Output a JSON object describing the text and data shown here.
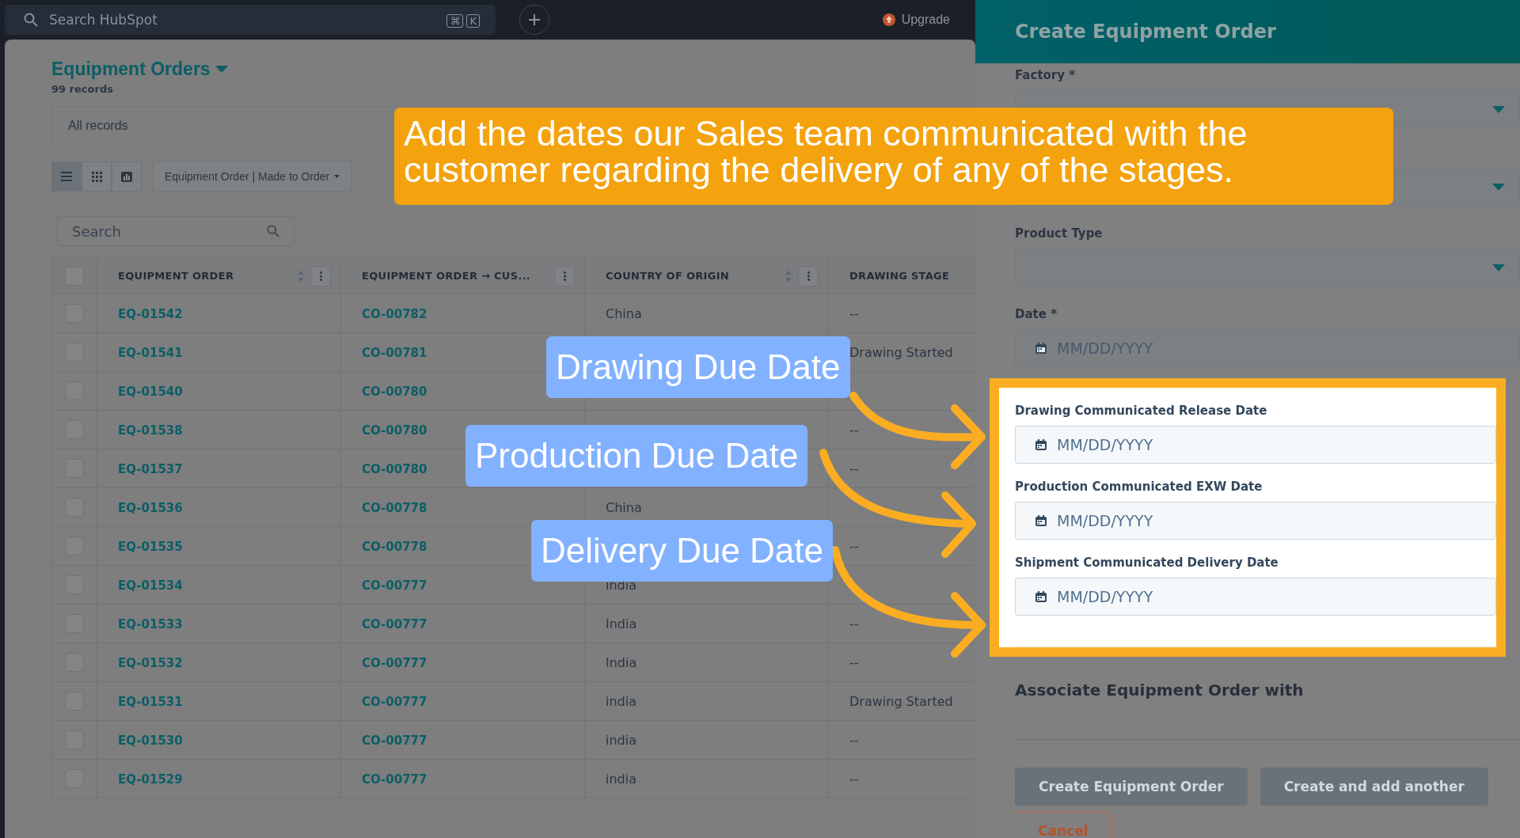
{
  "top_bar": {
    "search_placeholder": "Search HubSpot",
    "shortcut_keys": [
      "⌘",
      "K"
    ],
    "upgrade": "Upgrade"
  },
  "list": {
    "title": "Equipment Orders",
    "record_count": "99 records",
    "view_tab": "All records",
    "views": [
      {
        "kind": "list",
        "selected": true
      },
      {
        "kind": "grid",
        "selected": false
      },
      {
        "kind": "chart",
        "selected": false
      }
    ],
    "filter": "Equipment Order | Made to Order",
    "search_placeholder": "Search",
    "table": {
      "columns": [
        {
          "label": "EQUIPMENT ORDER",
          "sortable": true,
          "menu": true
        },
        {
          "label": "EQUIPMENT ORDER → CUS...",
          "sortable": false,
          "menu": true
        },
        {
          "label": "COUNTRY OF ORIGIN",
          "sortable": true,
          "menu": true
        },
        {
          "label": "DRAWING STAGE",
          "sortable": false,
          "menu": false
        }
      ],
      "select_all_checked": false,
      "rows": [
        {
          "checked": false,
          "cells": [
            "EQ-01542",
            "CO-00782",
            "China",
            "--"
          ]
        },
        {
          "checked": false,
          "cells": [
            "EQ-01541",
            "CO-00781",
            "",
            "Drawing Started"
          ]
        },
        {
          "checked": false,
          "cells": [
            "EQ-01540",
            "CO-00780",
            "",
            ""
          ]
        },
        {
          "checked": false,
          "cells": [
            "EQ-01538",
            "CO-00780",
            "",
            "--"
          ]
        },
        {
          "checked": false,
          "cells": [
            "EQ-01537",
            "CO-00780",
            "",
            "--"
          ]
        },
        {
          "checked": false,
          "cells": [
            "EQ-01536",
            "CO-00778",
            "China",
            ""
          ]
        },
        {
          "checked": false,
          "cells": [
            "EQ-01535",
            "CO-00778",
            "",
            "--"
          ]
        },
        {
          "checked": false,
          "cells": [
            "EQ-01534",
            "CO-00777",
            "india",
            ""
          ]
        },
        {
          "checked": false,
          "cells": [
            "EQ-01533",
            "CO-00777",
            "India",
            "--"
          ]
        },
        {
          "checked": false,
          "cells": [
            "EQ-01532",
            "CO-00777",
            "India",
            "--"
          ]
        },
        {
          "checked": false,
          "cells": [
            "EQ-01531",
            "CO-00777",
            "india",
            "Drawing Started"
          ]
        },
        {
          "checked": false,
          "cells": [
            "EQ-01530",
            "CO-00777",
            "india",
            "--"
          ]
        },
        {
          "checked": false,
          "cells": [
            "EQ-01529",
            "CO-00777",
            "india",
            "--"
          ]
        }
      ]
    }
  },
  "panel": {
    "title": "Create Equipment Order",
    "fields": [
      {
        "label": "Factory *",
        "kind": "select"
      },
      {
        "kind": "select"
      },
      {
        "label": "Product Type",
        "kind": "select"
      },
      {
        "label": "Date *",
        "kind": "date",
        "placeholder": "MM/DD/YYYY"
      }
    ],
    "highlighted_fields": [
      {
        "label": "Drawing Communicated Release Date",
        "kind": "date",
        "placeholder": "MM/DD/YYYY"
      },
      {
        "label": "Production Communicated EXW Date",
        "kind": "date",
        "placeholder": "MM/DD/YYYY"
      },
      {
        "label": "Shipment Communicated Delivery Date",
        "kind": "date",
        "placeholder": "MM/DD/YYYY"
      }
    ],
    "association_heading": "Associate Equipment Order with",
    "buttons": [
      {
        "label": "Create Equipment Order",
        "disabled": true
      },
      {
        "label": "Create and add another",
        "disabled": true
      }
    ],
    "cancel": "Cancel"
  },
  "annotations": {
    "callout": "Add the dates our Sales team communicated with the customer regarding the delivery of any of the stages.",
    "labels": [
      {
        "text": "Drawing Due Date"
      },
      {
        "text": "Production Due Date"
      },
      {
        "text": "Delivery Due Date"
      }
    ]
  }
}
